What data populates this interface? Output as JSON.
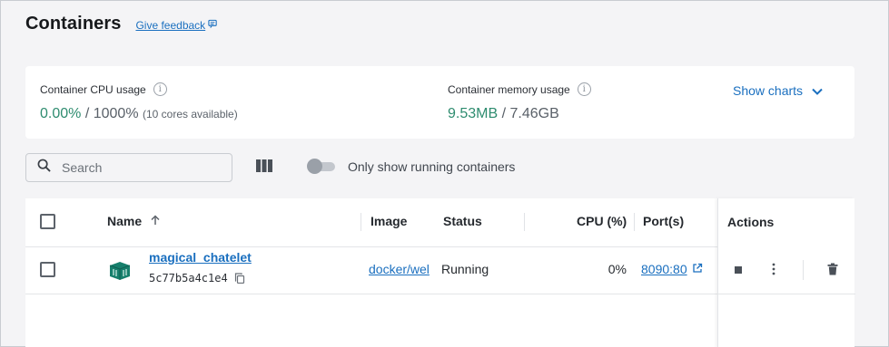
{
  "header": {
    "title": "Containers",
    "feedback_label": "Give feedback"
  },
  "stats": {
    "cpu": {
      "label": "Container CPU usage",
      "used": "0.00%",
      "separator": " / ",
      "total": "1000%",
      "note": "(10 cores available)"
    },
    "memory": {
      "label": "Container memory usage",
      "used": "9.53MB",
      "separator": " / ",
      "total": "7.46GB"
    },
    "show_charts_label": "Show charts"
  },
  "toolbar": {
    "search_placeholder": "Search",
    "toggle_label": "Only show running containers",
    "toggle_on": false
  },
  "table": {
    "columns": {
      "name": "Name",
      "image": "Image",
      "status": "Status",
      "cpu": "CPU (%)",
      "ports": "Port(s)",
      "actions": "Actions"
    },
    "rows": [
      {
        "name": "magical_chatelet",
        "id": "5c77b5a4c1e4",
        "image": "docker/wel",
        "status": "Running",
        "cpu": "0%",
        "port": "8090:80"
      }
    ]
  },
  "icons": {
    "feedback": "feedback-icon",
    "info": "info-icon",
    "chevron": "chevron-down-icon",
    "search": "search-icon",
    "columns": "columns-icon",
    "sort": "arrow-up-icon",
    "container": "container-icon",
    "copy": "copy-icon",
    "external": "external-link-icon",
    "stop": "stop-icon",
    "more": "more-vertical-icon",
    "delete": "trash-icon"
  },
  "colors": {
    "accent": "#1a6fbf",
    "success": "#2e8c6f",
    "container_icon": "#167f6c"
  }
}
